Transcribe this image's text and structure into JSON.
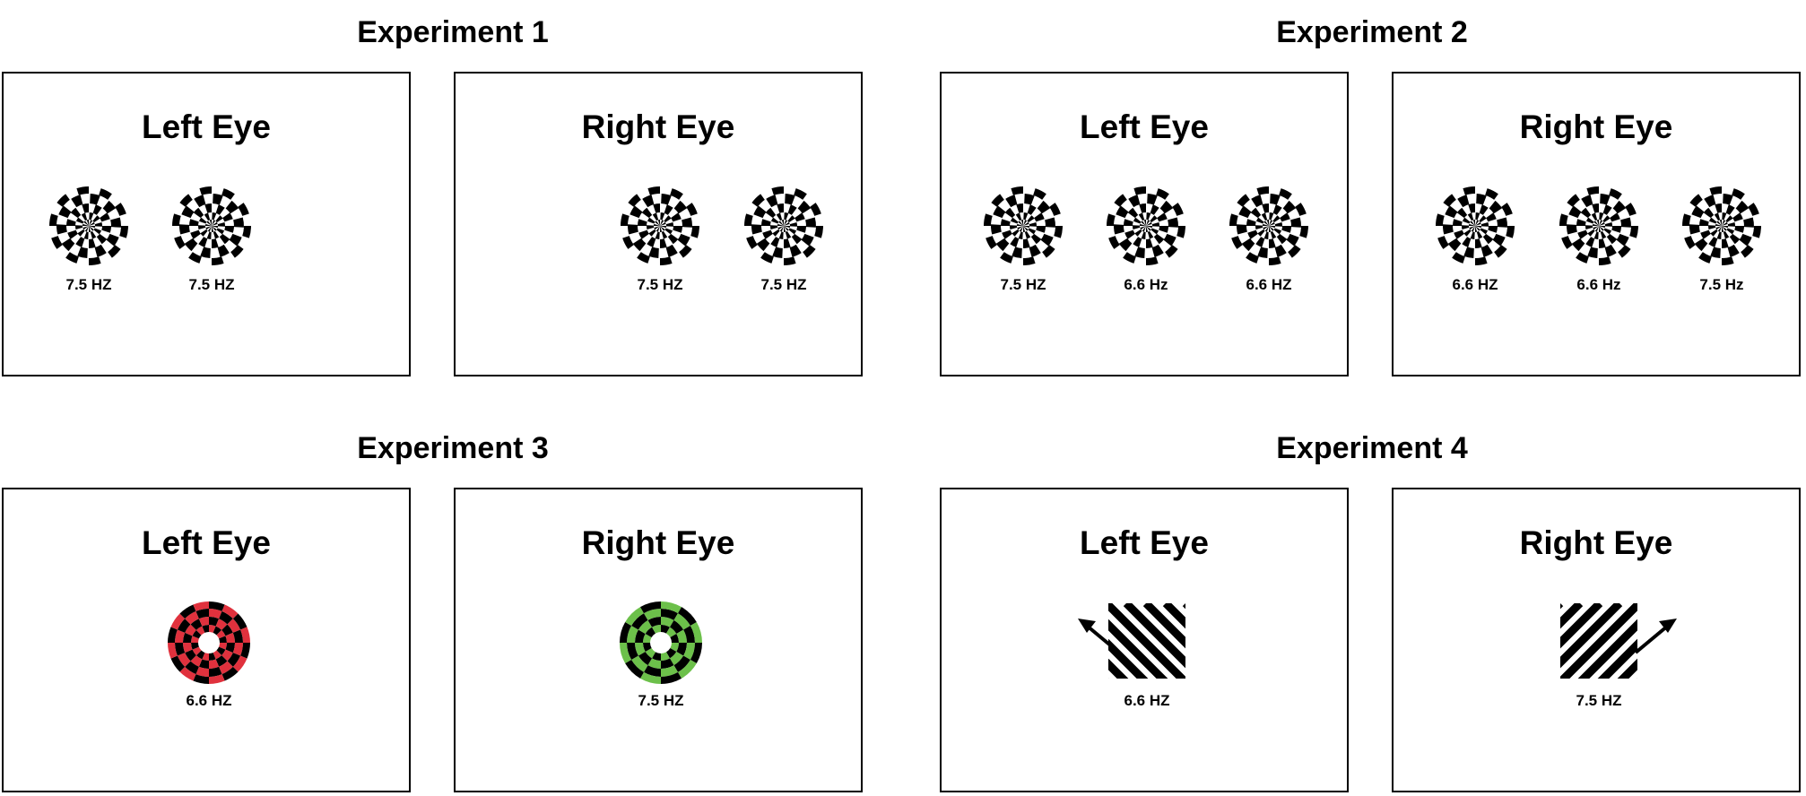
{
  "colors": {
    "red": "#e0313d",
    "green": "#6cc04a",
    "black": "#000000"
  },
  "experiments": [
    {
      "title": "Experiment 1",
      "panels": [
        {
          "label": "Left Eye",
          "stimuli": [
            {
              "kind": "checkerboard",
              "frequency": "7.5 HZ"
            },
            {
              "kind": "checkerboard",
              "frequency": "7.5 HZ"
            }
          ]
        },
        {
          "label": "Right Eye",
          "stimuli": [
            {
              "kind": "checkerboard",
              "frequency": "7.5 HZ"
            },
            {
              "kind": "checkerboard",
              "frequency": "7.5 HZ"
            }
          ]
        }
      ]
    },
    {
      "title": "Experiment 2",
      "panels": [
        {
          "label": "Left Eye",
          "stimuli": [
            {
              "kind": "checkerboard",
              "frequency": "7.5 HZ"
            },
            {
              "kind": "checkerboard",
              "frequency": "6.6 Hz"
            },
            {
              "kind": "checkerboard",
              "frequency": "6.6 HZ"
            }
          ]
        },
        {
          "label": "Right Eye",
          "stimuli": [
            {
              "kind": "checkerboard",
              "frequency": "6.6 HZ"
            },
            {
              "kind": "checkerboard",
              "frequency": "6.6 Hz"
            },
            {
              "kind": "checkerboard",
              "frequency": "7.5 Hz"
            }
          ]
        }
      ]
    },
    {
      "title": "Experiment 3",
      "panels": [
        {
          "label": "Left Eye",
          "stimuli": [
            {
              "kind": "red-ring-checkerboard",
              "frequency": "6.6 HZ"
            }
          ]
        },
        {
          "label": "Right Eye",
          "stimuli": [
            {
              "kind": "green-ring-checkerboard",
              "frequency": "7.5 HZ"
            }
          ]
        }
      ]
    },
    {
      "title": "Experiment 4",
      "panels": [
        {
          "label": "Left Eye",
          "stimuli": [
            {
              "kind": "grating-arrow-up-left",
              "frequency": "6.6 HZ"
            }
          ]
        },
        {
          "label": "Right Eye",
          "stimuli": [
            {
              "kind": "grating-arrow-up-right",
              "frequency": "7.5 HZ"
            }
          ]
        }
      ]
    }
  ]
}
